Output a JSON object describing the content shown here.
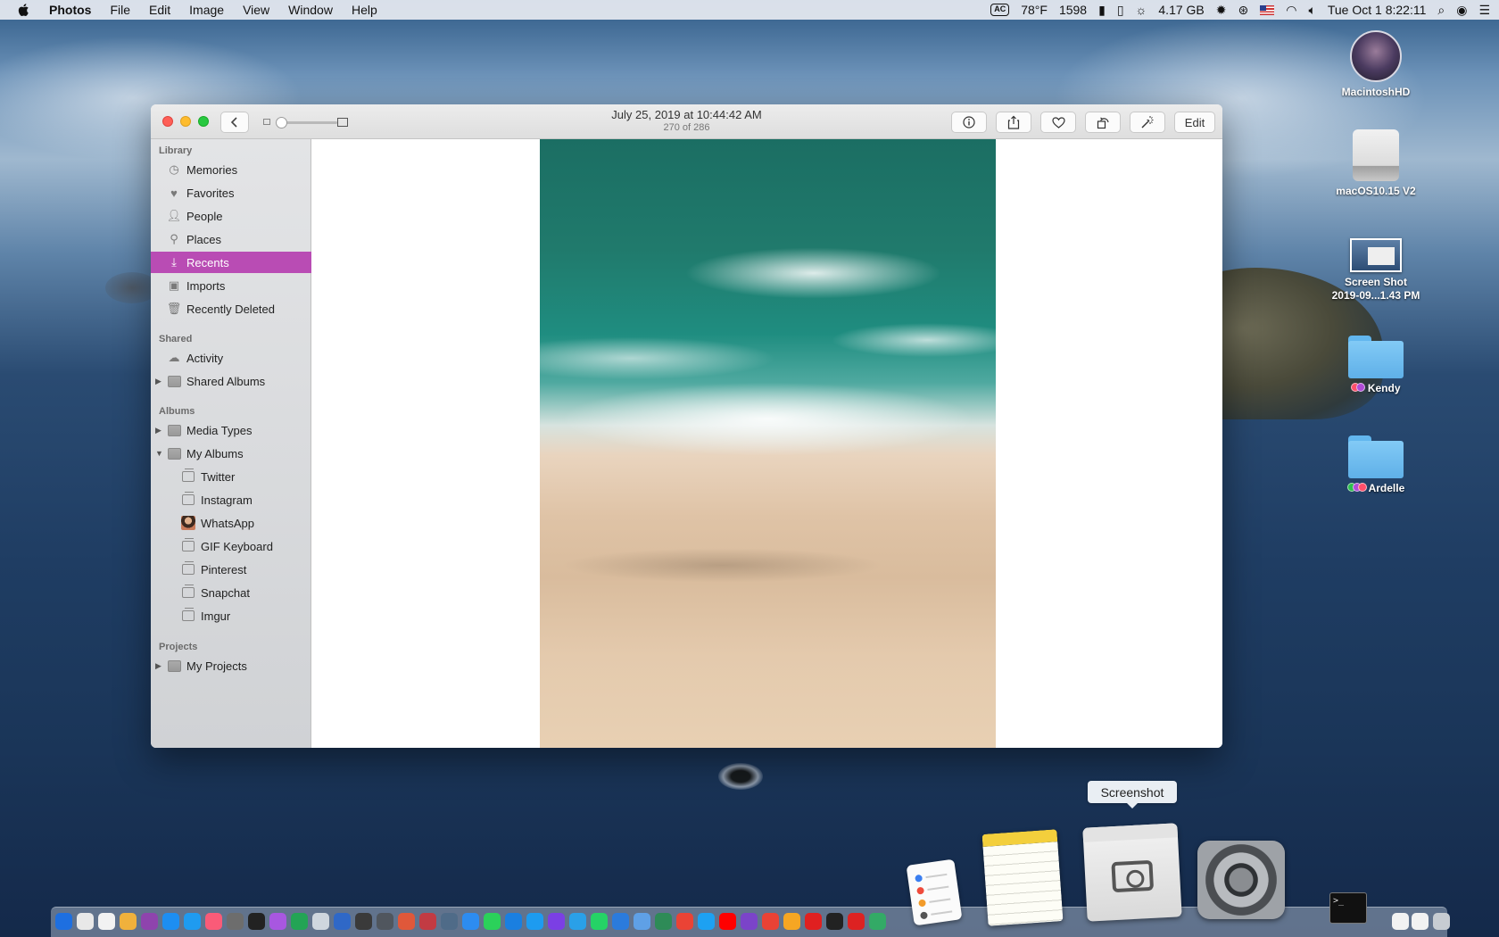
{
  "menubar": {
    "app_name": "Photos",
    "menus": [
      "File",
      "Edit",
      "Image",
      "View",
      "Window",
      "Help"
    ],
    "power_badge": "AC",
    "temperature": "78°F",
    "counter": "1598",
    "memory": "4.17 GB",
    "datetime": "Tue Oct 1  8:22:11"
  },
  "desktop": {
    "icons": [
      {
        "label": "MacintoshHD"
      },
      {
        "label": "macOS10.15 V2"
      },
      {
        "label": "Screen Shot\n2019-09...1.43 PM"
      },
      {
        "label": "Kendy",
        "tags": [
          "#ff4f6a",
          "#b04bd6"
        ]
      },
      {
        "label": "Ardelle",
        "tags": [
          "#2dbf4d",
          "#b04bd6",
          "#ff4f6a"
        ]
      }
    ]
  },
  "window": {
    "title": "July 25, 2019 at 10:44:42 AM",
    "subtitle": "270 of 286",
    "edit_label": "Edit"
  },
  "sidebar": {
    "sections": {
      "library": "Library",
      "shared": "Shared",
      "albums": "Albums",
      "projects": "Projects"
    },
    "library_items": [
      "Memories",
      "Favorites",
      "People",
      "Places",
      "Recents",
      "Imports",
      "Recently Deleted"
    ],
    "shared_items": [
      "Activity",
      "Shared Albums"
    ],
    "album_items": [
      "Media Types",
      "My Albums"
    ],
    "my_albums": [
      "Twitter",
      "Instagram",
      "WhatsApp",
      "GIF Keyboard",
      "Pinterest",
      "Snapchat",
      "Imgur"
    ],
    "project_items": [
      "My Projects"
    ],
    "selected": "Recents",
    "accent_color": "#b94cb4"
  },
  "dock": {
    "tooltip": "Screenshot"
  }
}
